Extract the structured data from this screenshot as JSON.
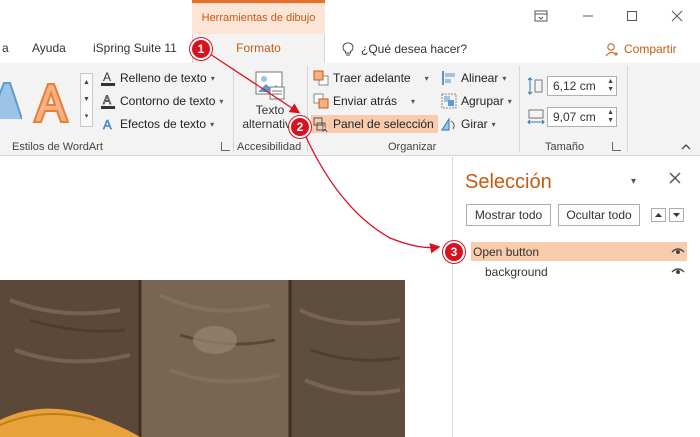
{
  "titlebar": {
    "tools_tab": "Herramientas de dibujo"
  },
  "tabs": [
    {
      "label": "a"
    },
    {
      "label": "Ayuda"
    },
    {
      "label": "iSpring Suite 11"
    }
  ],
  "active_tab": "Formato",
  "tell_me": "¿Qué desea hacer?",
  "share": "Compartir",
  "wordart": {
    "fill": "Relleno de texto",
    "outline": "Contorno de texto",
    "effects": "Efectos de texto",
    "group_label": "Estilos de WordArt"
  },
  "accessibility": {
    "alt_text_line1": "Texto",
    "alt_text_line2": "alternativo",
    "group_label": "Accesibilidad"
  },
  "organize": {
    "bring_forward": "Traer adelante",
    "send_backward": "Enviar atrás",
    "selection_pane": "Panel de selección",
    "align": "Alinear",
    "group": "Agrupar",
    "rotate": "Girar",
    "group_label": "Organizar"
  },
  "size": {
    "height": "6,12 cm",
    "width": "9,07 cm",
    "group_label": "Tamaño"
  },
  "selection_pane": {
    "title": "Selección",
    "show_all": "Mostrar todo",
    "hide_all": "Ocultar todo",
    "items": [
      {
        "label": "Open button",
        "selected": true
      },
      {
        "label": "background",
        "selected": false
      }
    ]
  },
  "callouts": [
    "1",
    "2",
    "3"
  ],
  "colors": {
    "accent": "#c55a11",
    "highlight": "#f8cbad",
    "badge": "#d9121f",
    "tools_tab_bg": "#fce4d6"
  }
}
